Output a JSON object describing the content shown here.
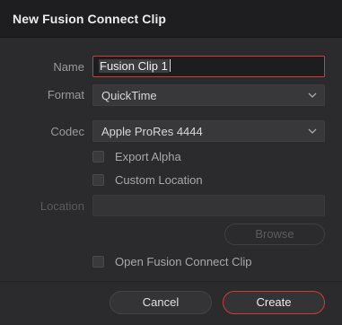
{
  "dialog": {
    "title": "New Fusion Connect Clip"
  },
  "form": {
    "name_label": "Name",
    "name_value": "Fusion Clip 1",
    "format_label": "Format",
    "format_value": "QuickTime",
    "codec_label": "Codec",
    "codec_value": "Apple ProRes 4444",
    "export_alpha_label": "Export Alpha",
    "export_alpha_checked": false,
    "custom_location_label": "Custom Location",
    "custom_location_checked": false,
    "location_label": "Location",
    "location_value": "",
    "browse_label": "Browse",
    "open_clip_label": "Open Fusion Connect Clip",
    "open_clip_checked": false
  },
  "buttons": {
    "cancel_label": "Cancel",
    "create_label": "Create"
  },
  "colors": {
    "accent": "#d23a3a",
    "background": "#2b2b2d",
    "titlebar": "#1e1e20",
    "field": "#38383a"
  },
  "icons": {
    "dropdown": "chevron-down-icon"
  }
}
